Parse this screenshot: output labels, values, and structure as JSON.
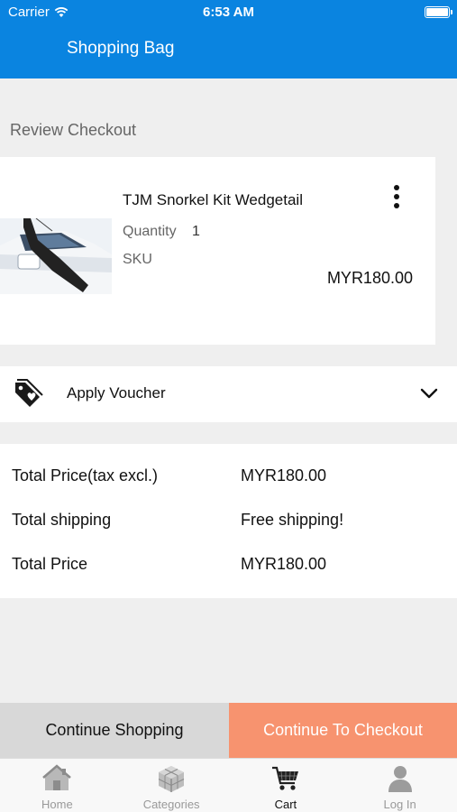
{
  "status_bar": {
    "carrier": "Carrier",
    "time": "6:53 AM"
  },
  "nav": {
    "title": "Shopping Bag"
  },
  "review": {
    "label": "Review Checkout"
  },
  "cart_item": {
    "name": "TJM Snorkel Kit Wedgetail",
    "quantity_label": "Quantity",
    "quantity": "1",
    "sku_label": "SKU",
    "price": "MYR180.00"
  },
  "voucher": {
    "label": "Apply Voucher"
  },
  "totals": {
    "rows": [
      {
        "label": "Total Price(tax excl.)",
        "value": "MYR180.00"
      },
      {
        "label": "Total shipping",
        "value": "Free shipping!"
      },
      {
        "label": "Total Price",
        "value": "MYR180.00"
      }
    ]
  },
  "actions": {
    "continue_shopping": "Continue Shopping",
    "continue_checkout": "Continue To Checkout"
  },
  "tabs": [
    {
      "label": "Home",
      "icon": "home-icon",
      "active": false
    },
    {
      "label": "Categories",
      "icon": "categories-icon",
      "active": false
    },
    {
      "label": "Cart",
      "icon": "cart-icon",
      "active": true
    },
    {
      "label": "Log In",
      "icon": "user-icon",
      "active": false
    }
  ],
  "colors": {
    "primary": "#0a84e0",
    "checkout": "#f7936f",
    "continue": "#d8d8d8",
    "background": "#efefef"
  }
}
